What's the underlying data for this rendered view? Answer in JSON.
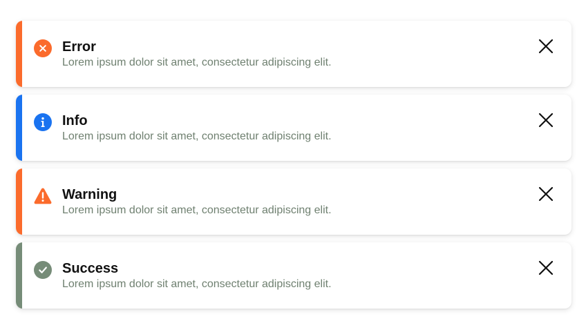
{
  "toasts": [
    {
      "type": "error",
      "title": "Error",
      "message": "Lorem ipsum dolor sit amet, consectetur adipiscing elit.",
      "icon": "error-x-circle-icon",
      "accent_color": "#fb6b2c"
    },
    {
      "type": "info",
      "title": "Info",
      "message": "Lorem ipsum dolor sit amet, consectetur adipiscing elit.",
      "icon": "info-circle-icon",
      "accent_color": "#1a73f0"
    },
    {
      "type": "warning",
      "title": "Warning",
      "message": "Lorem ipsum dolor sit amet, consectetur adipiscing elit.",
      "icon": "warning-triangle-icon",
      "accent_color": "#fb6b2c"
    },
    {
      "type": "success",
      "title": "Success",
      "message": "Lorem ipsum dolor sit amet, consectetur adipiscing elit.",
      "icon": "check-circle-icon",
      "accent_color": "#768c78"
    }
  ],
  "close_icon": "close-icon"
}
